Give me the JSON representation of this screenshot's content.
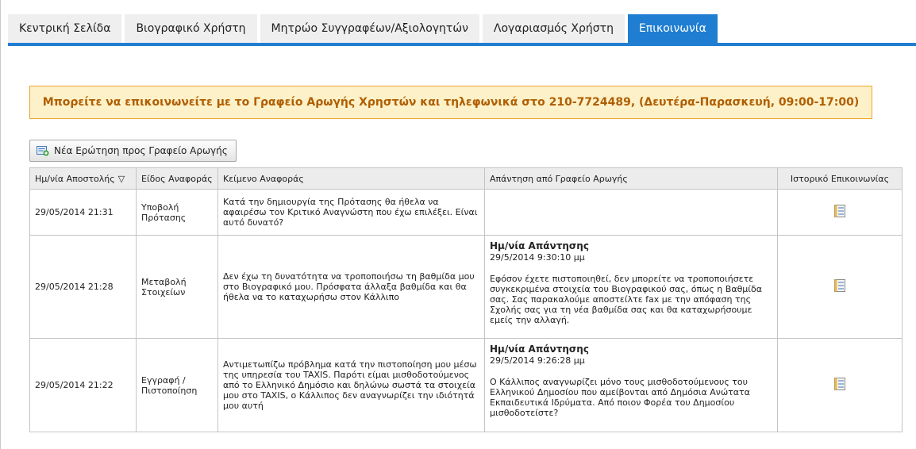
{
  "tabs": [
    {
      "label": "Κεντρική Σελίδα",
      "active": false
    },
    {
      "label": "Βιογραφικό Χρήστη",
      "active": false
    },
    {
      "label": "Μητρώο Συγγραφέων/Αξιολογητών",
      "active": false
    },
    {
      "label": "Λογαριασμός Χρήστη",
      "active": false
    },
    {
      "label": "Επικοινωνία",
      "active": true
    }
  ],
  "notice": "Μπορείτε να επικοινωνείτε με το Γραφείο Αρωγής Χρηστών και τηλεφωνικά στο 210-7724489, (Δευτέρα-Παρασκευή, 09:00-17:00)",
  "new_question_button": "Νέα Ερώτηση προς Γραφείο Αρωγής",
  "colors": {
    "tab_active": "#1f7ed1",
    "notice_bg": "#fdf1c9",
    "notice_border": "#f0a530",
    "notice_text": "#b05e00"
  },
  "table": {
    "headers": {
      "date": "Ημ/νία Αποστολής",
      "type": "Είδος Αναφοράς",
      "text": "Κείμενο Αναφοράς",
      "answer": "Απάντηση από Γραφείο Αρωγής",
      "history": "Ιστορικό Επικοινωνίας"
    },
    "sort_icon": "triangle-down-icon",
    "rows": [
      {
        "date": "29/05/2014 21:31",
        "type": "Υποβολή Πρότασης",
        "text": "Κατά την δημιουργία της Πρότασης θα ήθελα να αφαιρέσω τον Κριτικό Αναγνώστη που έχω επιλέξει. Είναι αυτό δυνατό?",
        "answer_title": "",
        "answer_date": "",
        "answer_text": ""
      },
      {
        "date": "29/05/2014 21:28",
        "type": "Μεταβολή Στοιχείων",
        "text": "Δεν έχω τη δυνατότητα να τροποποιήσω τη βαθμίδα μου στο Βιογραφικό μου. Πρόσφατα άλλαξα βαθμίδα και θα ήθελα να το καταχωρήσω στον Κάλλιπο",
        "answer_title": "Ημ/νία Απάντησης",
        "answer_date": "29/5/2014 9:30:10 μμ",
        "answer_text": "Εφόσον έχετε πιστοποιηθεί, δεν μπορείτε να τροποποιήσετε συγκεκριμένα στοιχεία του Βιογραφικού σας, όπως η Βαθμίδα σας. Σας παρακαλούμε αποστείλτε fax με την απόφαση της Σχολής σας για τη νέα βαθμίδα σας και θα καταχωρήσουμε εμείς την αλλαγή."
      },
      {
        "date": "29/05/2014 21:22",
        "type": "Εγγραφή / Πιστοποίηση",
        "text": "Αντιμετωπίζω πρόβλημα κατά την πιστοποίηση μου μέσω της υπηρεσία του TAXIS. Παρότι είμαι μισθοδοτούμενος από το Ελληνικό Δημόσιο και δηλώνω σωστά τα στοιχεία μου στο TAXIS, ο Κάλλιπος δεν αναγνωρίζει την ιδιότητά μου αυτή",
        "answer_title": "Ημ/νία Απάντησης",
        "answer_date": "29/5/2014 9:26:28 μμ",
        "answer_text": "Ο Κάλλιπος αναγνωρίζει μόνο τους μισθοδοτούμενους του Ελληνικού Δημοσίου που αμείβονται από Δημόσια Ανώτατα Εκπαιδευτικά Ιδρύματα. Από ποιον Φορέα του Δημοσίου μισθοδοτείστε?"
      }
    ]
  }
}
